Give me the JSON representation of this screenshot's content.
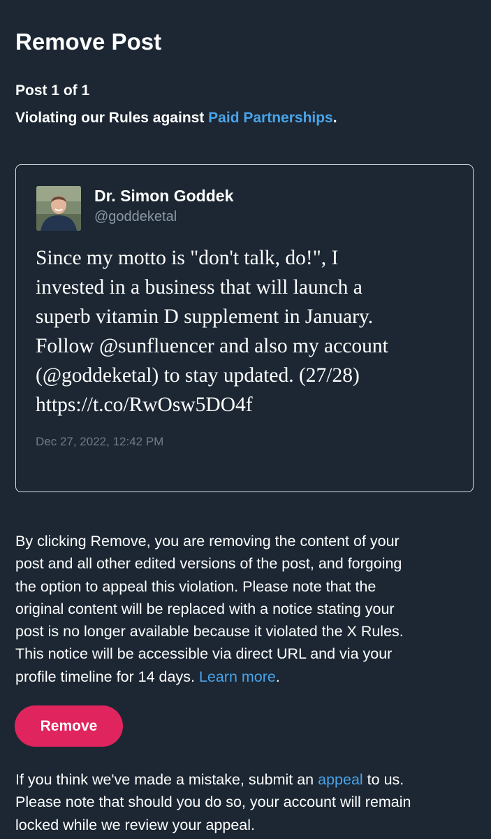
{
  "page": {
    "title": "Remove Post",
    "post_count": "Post 1 of 1",
    "violation_prefix": "Violating our Rules against ",
    "violation_link": "Paid Partnerships",
    "violation_suffix": "."
  },
  "post": {
    "display_name": "Dr. Simon Goddek",
    "handle": "@goddeketal",
    "body_lines": [
      "Since my motto is \"don't talk, do!\", I",
      "invested in a business that will launch a",
      "superb vitamin D supplement in January.",
      "Follow @sunfluencer and also my account",
      "(@goddeketal) to stay updated. (27/28)",
      "https://t.co/RwOsw5DO4f"
    ],
    "timestamp": "Dec 27, 2022, 12:42 PM"
  },
  "notice": {
    "lines": [
      "By clicking Remove, you are removing the content of your",
      "post and all other edited versions of the post, and forgoing",
      "the option to appeal this violation. Please note that the",
      "original content will be replaced with a notice stating your",
      "post is no longer available because it violated the X Rules.",
      "This notice will be accessible via direct URL and via your"
    ],
    "last_line_prefix": "profile timeline for 14 days. ",
    "learn_more": "Learn more",
    "last_line_suffix": "."
  },
  "remove_button": {
    "label": "Remove",
    "color": "#e0245e"
  },
  "appeal": {
    "line1_prefix": "If you think we've made a mistake, submit an ",
    "appeal_link": "appeal",
    "line1_suffix": " to us.",
    "line2": "Please note that should you do so, your account will remain",
    "line3": "locked while we review your appeal."
  },
  "colors": {
    "background": "#1c2733",
    "link": "#4aa3e8",
    "secondary_text": "#8b98a5"
  }
}
